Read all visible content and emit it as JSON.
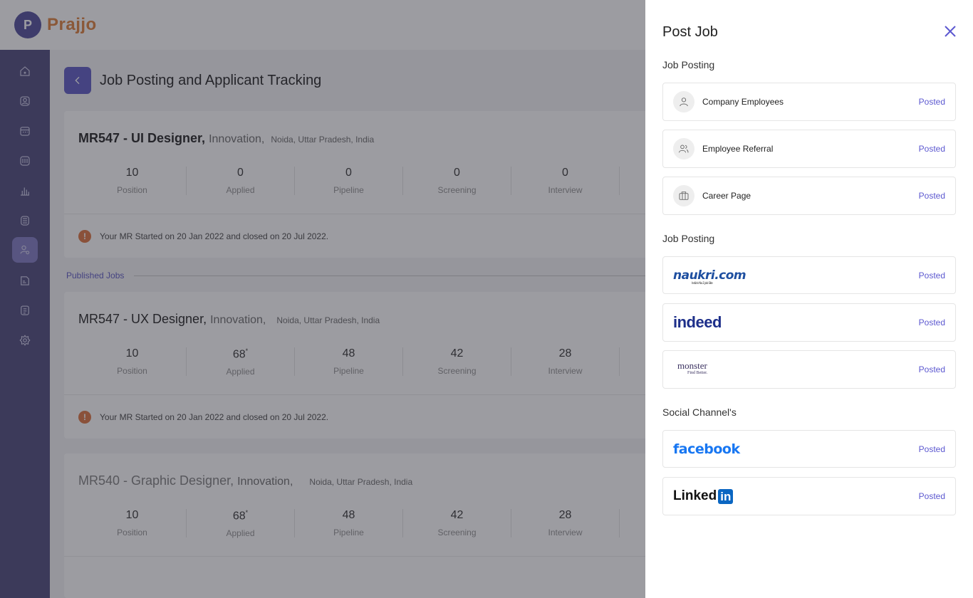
{
  "app": {
    "logo_letter": "P",
    "logo_name": "Prajjo"
  },
  "sidebar": {
    "items": [
      {
        "icon": "home-icon"
      },
      {
        "icon": "user-icon"
      },
      {
        "icon": "calendar-icon"
      },
      {
        "icon": "book-icon"
      },
      {
        "icon": "bar-chart-icon"
      },
      {
        "icon": "calculator-icon"
      },
      {
        "icon": "recruitment-icon",
        "active": true
      },
      {
        "icon": "folder-icon"
      },
      {
        "icon": "document-icon"
      },
      {
        "icon": "gear-icon"
      }
    ]
  },
  "page": {
    "title": "Job Posting and Applicant Tracking"
  },
  "stat_labels": [
    "Position",
    "Applied",
    "Pipeline",
    "Screening",
    "Interview"
  ],
  "jobs": [
    {
      "code": "MR547 - UI Designer,",
      "dept": "Innovation,",
      "location": "Noida, Uttar Pradesh, India",
      "stats": [
        "10",
        "0",
        "0",
        "0",
        "0"
      ],
      "footer": "Your MR Started on 20 Jan 2022 and closed on 20 Jul 2022."
    },
    {
      "code": "MR547 - UX Designer,",
      "dept": "Innovation,",
      "location": "Noida, Uttar Pradesh, India",
      "stats": [
        "10",
        "68",
        "48",
        "42",
        "28"
      ],
      "applied_marker": "*",
      "footer": "Your MR Started on 20 Jan 2022 and closed on 20 Jul 2022."
    },
    {
      "code": "MR540 - Graphic Designer,",
      "dept": "Innovation,",
      "location": "Noida, Uttar Pradesh, India",
      "stats": [
        "10",
        "68",
        "48",
        "42",
        "28"
      ],
      "applied_marker": "*"
    }
  ],
  "published_label": "Published Jobs",
  "drawer": {
    "title": "Post Job",
    "sections": [
      {
        "heading": "Job Posting",
        "rows": [
          {
            "label": "Company Employees",
            "icon": "person-icon",
            "status": "Posted"
          },
          {
            "label": "Employee Referral",
            "icon": "people-icon",
            "status": "Posted"
          },
          {
            "label": "Career Page",
            "icon": "briefcase-icon",
            "status": "Posted"
          }
        ]
      },
      {
        "heading": "Job Posting",
        "rows": [
          {
            "brand": "naukri.com",
            "tagline": "India's No.1 Job Site",
            "status": "Posted"
          },
          {
            "brand": "indeed",
            "status": "Posted"
          },
          {
            "brand": "monster",
            "tagline": "Find Better.",
            "status": "Posted"
          }
        ]
      },
      {
        "heading": "Social Channel's",
        "rows": [
          {
            "brand": "facebook",
            "status": "Posted"
          },
          {
            "brand_text": "Linked",
            "brand_badge": "in",
            "status": "Posted"
          }
        ]
      }
    ]
  }
}
